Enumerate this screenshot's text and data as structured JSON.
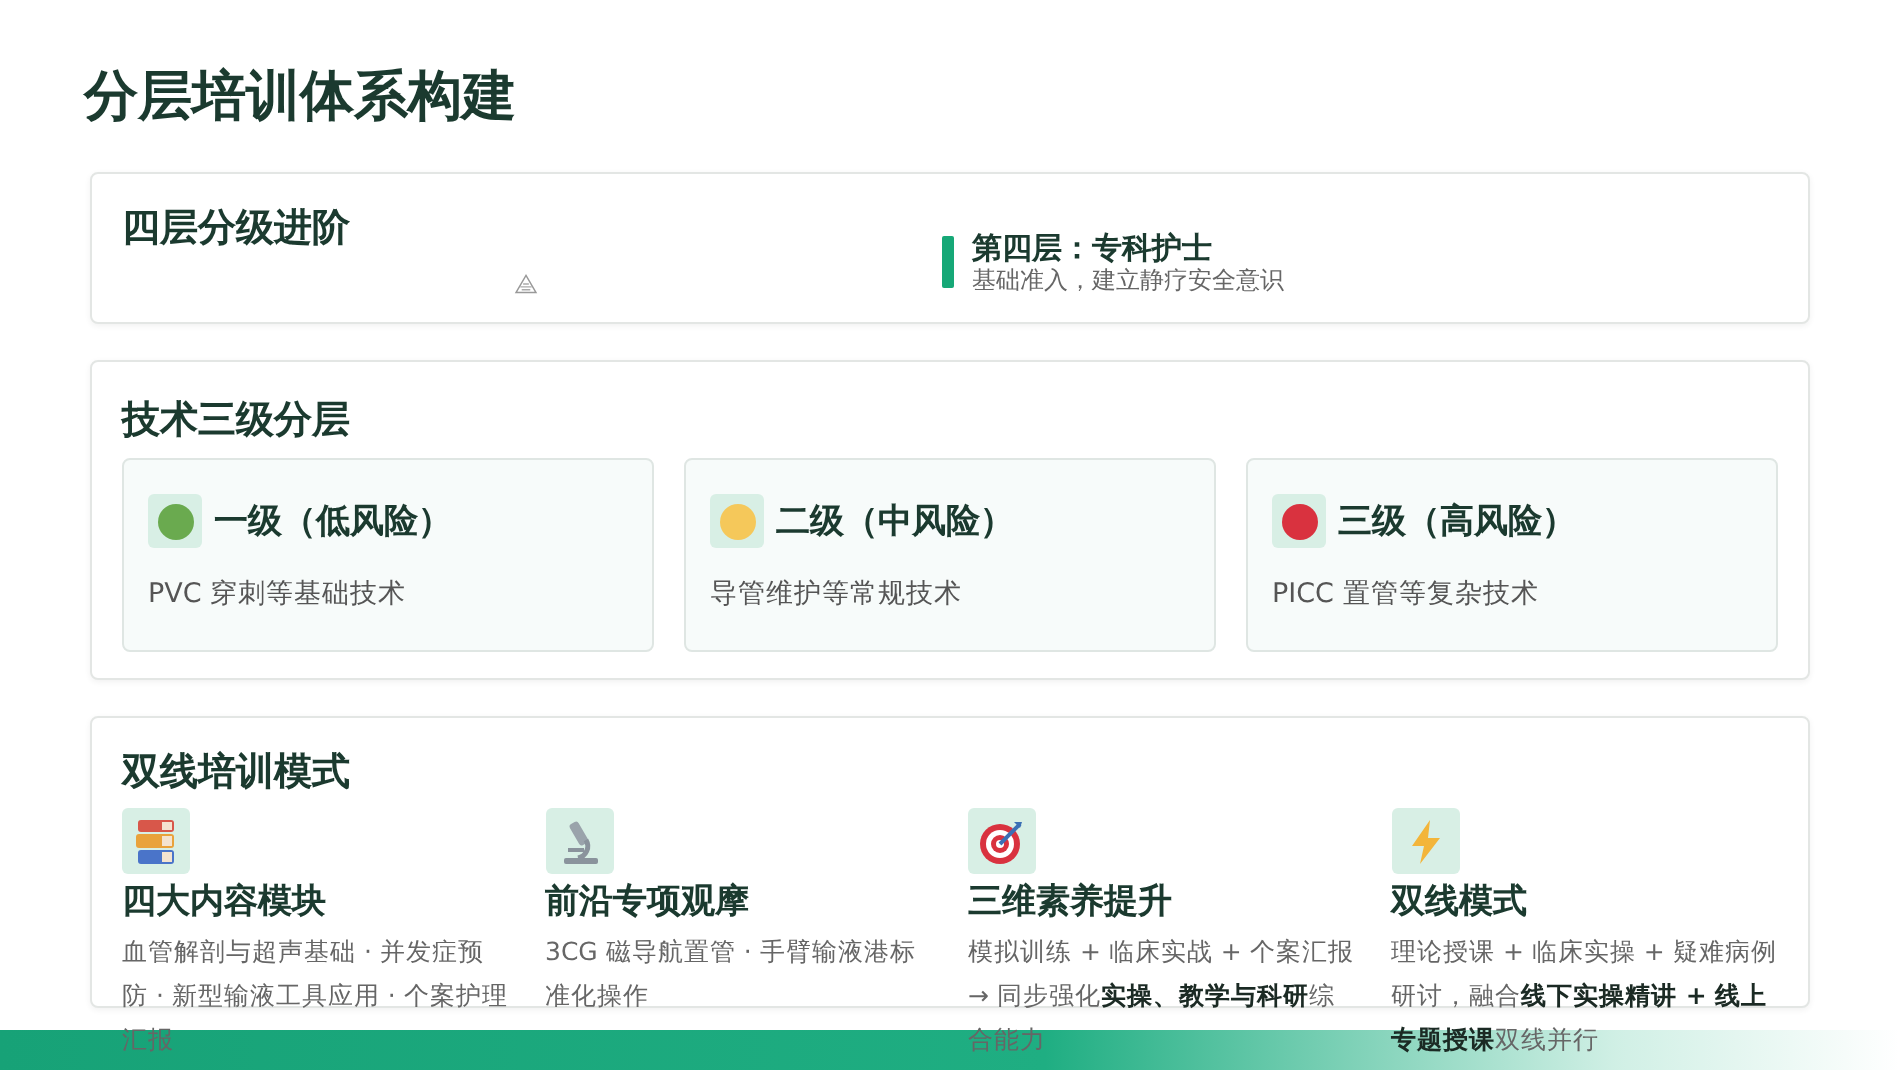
{
  "title": "分层培训体系构建",
  "four_levels": {
    "heading": "四层分级进阶",
    "tier": {
      "title": "第四层：专科护士",
      "description": "基础准入，建立静疗安全意识"
    }
  },
  "tech_levels": {
    "heading": "技术三级分层",
    "levels": [
      {
        "title": "一级（低风险）",
        "description": "PVC 穿刺等基础技术",
        "color": "#6aaa4f"
      },
      {
        "title": "二级（中风险）",
        "description": "导管维护等常规技术",
        "color": "#f5c85a"
      },
      {
        "title": "三级（高风险）",
        "description": "PICC 置管等复杂技术",
        "color": "#d9323f"
      }
    ]
  },
  "dual_mode": {
    "heading": "双线培训模式",
    "modules": [
      {
        "kind": "books",
        "title": "四大内容模块",
        "description": "血管解剖与超声基础 · 并发症预防 · 新型输液工具应用 · 个案护理汇报"
      },
      {
        "kind": "microscope",
        "title": "前沿专项观摩",
        "description": "3CG 磁导航置管 · 手臂输液港标准化操作"
      },
      {
        "kind": "target",
        "title": "三维素养提升",
        "description": "模拟训练 + 临床实战 + 个案汇报 → 同步强化**实操、教学与科研**综合能力"
      },
      {
        "kind": "bolt",
        "title": "双线模式",
        "description": "理论授课 + 临床实操 + 疑难病例研讨，融合**线下实操精讲 + 线上专题授课**双线并行"
      }
    ]
  }
}
